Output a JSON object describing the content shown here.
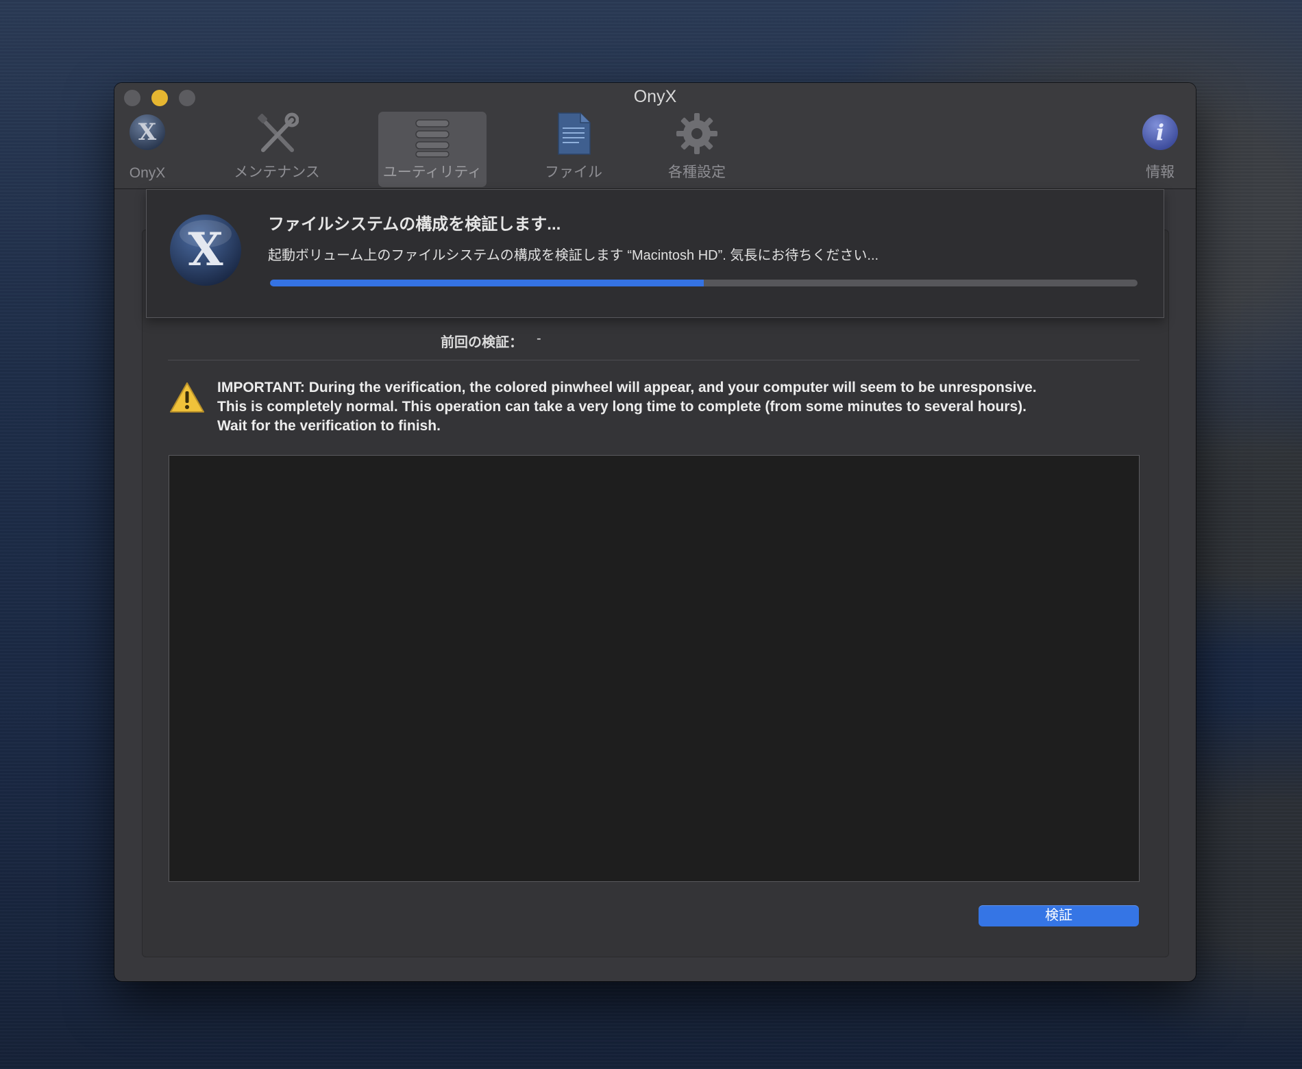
{
  "window": {
    "title": "OnyX"
  },
  "toolbar": {
    "items": [
      {
        "label": "OnyX",
        "icon": "onyx-logo-icon"
      },
      {
        "label": "メンテナンス",
        "icon": "wrench-screwdriver-icon"
      },
      {
        "label": "ユーティリティ",
        "icon": "wrenches-icon",
        "selected": true
      },
      {
        "label": "ファイル",
        "icon": "document-icon"
      },
      {
        "label": "各種設定",
        "icon": "gear-icon"
      },
      {
        "label": "情報",
        "icon": "info-icon"
      }
    ]
  },
  "sheet": {
    "title": "ファイルシステムの構成を検証します...",
    "message": "起動ボリューム上のファイルシステムの構成を検証します “Macintosh HD”. 気長にお待ちください...",
    "progress": 0.5
  },
  "last_check": {
    "label": "前回の検証：",
    "value": "-"
  },
  "warning": {
    "lines": [
      "IMPORTANT: During the verification, the colored pinwheel will appear, and your computer will seem to be unresponsive.",
      "This is completely normal. This operation can take a very long time to complete (from some minutes to several hours).",
      "Wait for the verification to finish."
    ]
  },
  "buttons": {
    "verify": "検証"
  },
  "colors": {
    "accent": "#3573e3",
    "warning": "#f0c23a"
  }
}
